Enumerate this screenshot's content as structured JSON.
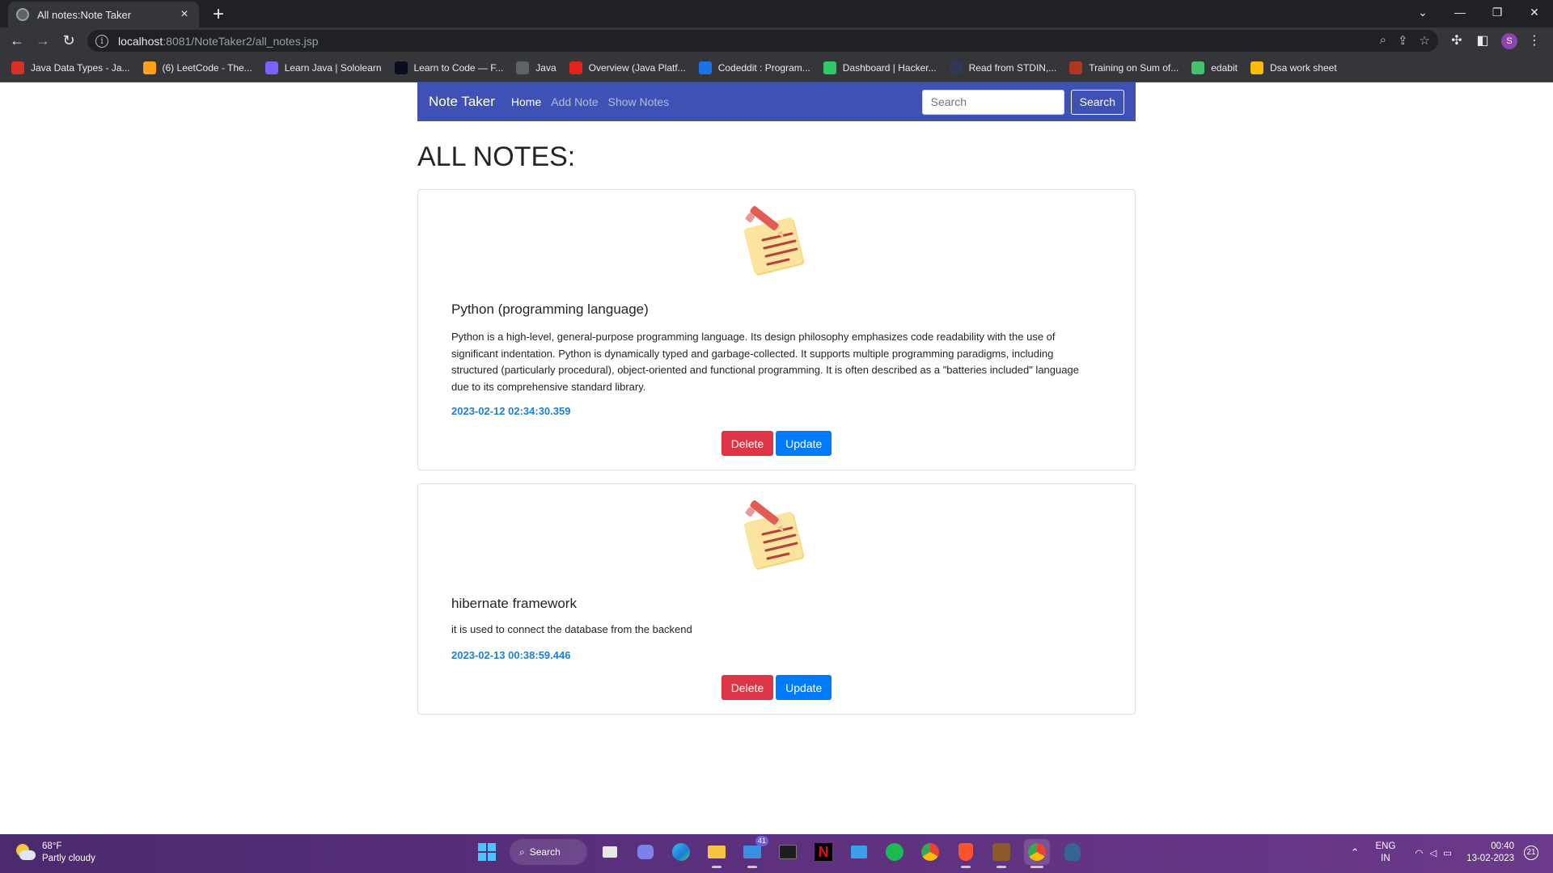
{
  "browser": {
    "tab_title": "All notes:Note Taker",
    "url_host": "localhost",
    "url_path": ":8081/NoteTaker2/all_notes.jsp",
    "profile_initial": "S"
  },
  "bookmarks": [
    {
      "label": "Java Data Types - Ja...",
      "icon": "vivaldi-red-icon",
      "color": "#d93025"
    },
    {
      "label": "(6) LeetCode - The...",
      "icon": "leetcode-icon",
      "color": "#ffa116"
    },
    {
      "label": "Learn Java | Sololearn",
      "icon": "sololearn-icon",
      "color": "#7b61ff"
    },
    {
      "label": "Learn to Code — F...",
      "icon": "freecodecamp-icon",
      "color": "#0a0a23"
    },
    {
      "label": "Java",
      "icon": "globe-icon",
      "color": "#5f6368"
    },
    {
      "label": "Overview (Java Platf...",
      "icon": "oracle-icon",
      "color": "#e2231a"
    },
    {
      "label": "Codeddit : Program...",
      "icon": "code-icon",
      "color": "#1a73e8"
    },
    {
      "label": "Dashboard | Hacker...",
      "icon": "hackerrank-icon",
      "color": "#2ec866"
    },
    {
      "label": "Read from STDIN,...",
      "icon": "hackerearth-icon",
      "color": "#323754"
    },
    {
      "label": "Training on Sum of...",
      "icon": "codewars-icon",
      "color": "#b1361e"
    },
    {
      "label": "edabit",
      "icon": "edabit-icon",
      "color": "#41c46b"
    },
    {
      "label": "Dsa work sheet",
      "icon": "google-drive-icon",
      "color": "#fbbc04"
    }
  ],
  "navbar": {
    "brand": "Note Taker",
    "links": [
      "Home",
      "Add Note",
      "Show Notes"
    ],
    "search_placeholder": "Search",
    "search_button": "Search",
    "color": "#3f51b5"
  },
  "heading": "ALL NOTES:",
  "notes": [
    {
      "title": "Python (programming language)",
      "content": "Python is a high-level, general-purpose programming language. Its design philosophy emphasizes code readability with the use of significant indentation. Python is dynamically typed and garbage-collected. It supports multiple programming paradigms, including structured (particularly procedural), object-oriented and functional programming. It is often described as a \"batteries included\" language due to its comprehensive standard library.",
      "date": "2023-02-12 02:34:30.359",
      "delete_label": "Delete",
      "update_label": "Update"
    },
    {
      "title": "hibernate framework",
      "content": "it is used to connect the database from the backend",
      "date": "2023-02-13 00:38:59.446",
      "delete_label": "Delete",
      "update_label": "Update"
    }
  ],
  "taskbar": {
    "weather_temp": "68°F",
    "weather_desc": "Partly cloudy",
    "search_label": "Search",
    "mail_badge": "41",
    "lang_1": "ENG",
    "lang_2": "IN",
    "time": "00:40",
    "date": "13-02-2023",
    "notification_count": "21"
  },
  "colors": {
    "delete": "#dc3545",
    "update": "#007bff",
    "date_text": "#1e7fd8"
  }
}
